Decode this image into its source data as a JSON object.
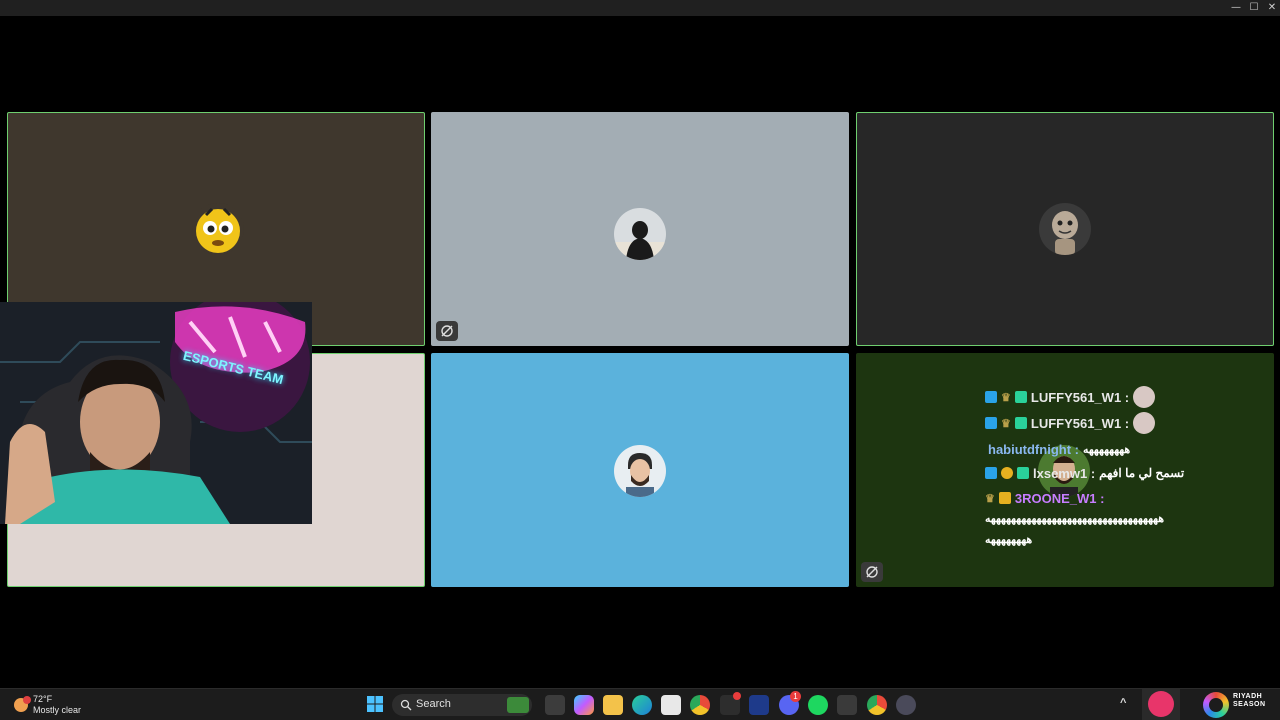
{
  "window": {
    "minimize": "—",
    "maximize": "☐",
    "close": "✕"
  },
  "tiles": [
    {
      "id": "tile-1",
      "bg": "#3f372d",
      "active": true
    },
    {
      "id": "tile-2",
      "bg": "#a3adb4",
      "active": false,
      "camera_off": true
    },
    {
      "id": "tile-3",
      "bg": "#272727",
      "active": true
    },
    {
      "id": "tile-4",
      "bg": "#e0d6d2",
      "active": true
    },
    {
      "id": "tile-5",
      "bg": "#5bb2dc",
      "active": false
    },
    {
      "id": "tile-6",
      "bg": "#1d3510",
      "active": false,
      "camera_off": true
    }
  ],
  "chat": {
    "messages": [
      {
        "user": "LUFFY561_W1 :",
        "text": "",
        "user_color": "#e8e8e8"
      },
      {
        "user": "LUFFY561_W1 :",
        "text": "",
        "user_color": "#e8e8e8"
      },
      {
        "user": "habiutdfnight :",
        "text": "ههههههههه",
        "user_color": "#8ab8f0"
      },
      {
        "user": "lxsemw1 :",
        "text": "تسمح لي ما افهم",
        "user_color": "#e8e8e8"
      },
      {
        "user": "3ROONE_W1 :",
        "text": "",
        "user_color": "#c77dff"
      }
    ],
    "spam_line_1": "ههههههههههههههههههههههههههههههههههه",
    "spam_line_2": "ههههههههه"
  },
  "webcam": {
    "neon_text": "ESPORTS TEAM"
  },
  "taskbar": {
    "weather": {
      "temp": "72°F",
      "desc": "Mostly clear",
      "alert_count": ""
    },
    "search_label": "Search",
    "discord_badge": "1",
    "riyadh_line1": "RIYADH",
    "riyadh_line2": "SEASON",
    "overflow": "^"
  }
}
